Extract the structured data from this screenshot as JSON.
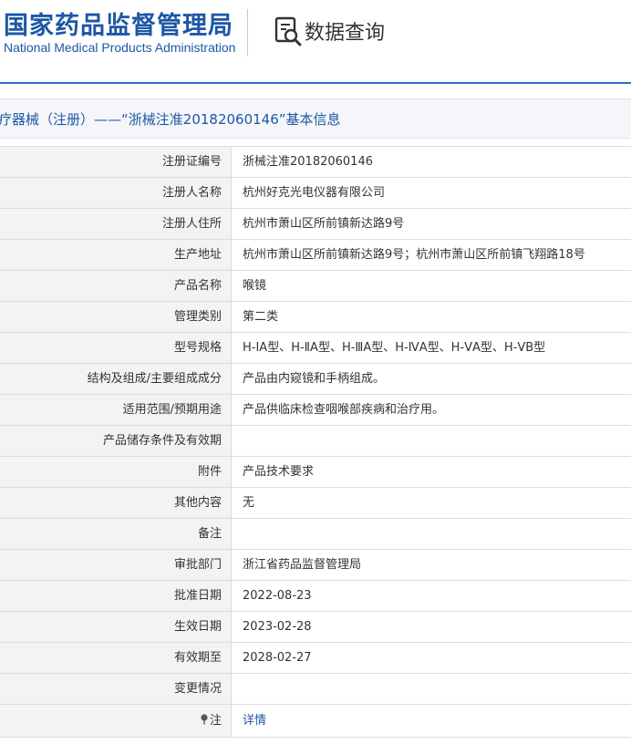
{
  "header": {
    "logo_cn": "国家药品监督管理局",
    "logo_en": "National Medical Products Administration",
    "query_label": "数据查询"
  },
  "record_title": {
    "prefix": "疗器械（注册）——“",
    "number": "浙械注准20182060146",
    "suffix": "”基本信息"
  },
  "rows": [
    {
      "label": "注册证编号",
      "value": "浙械注准20182060146"
    },
    {
      "label": "注册人名称",
      "value": "杭州好克光电仪器有限公司"
    },
    {
      "label": "注册人住所",
      "value": "杭州市萧山区所前镇新达路9号"
    },
    {
      "label": "生产地址",
      "value": "杭州市萧山区所前镇新达路9号；杭州市萧山区所前镇飞翔路18号"
    },
    {
      "label": "产品名称",
      "value": "喉镜"
    },
    {
      "label": "管理类别",
      "value": "第二类"
    },
    {
      "label": "型号规格",
      "value": "H-ⅠA型、H-ⅡA型、H-ⅢA型、H-ⅣA型、H-ⅤA型、H-ⅤB型"
    },
    {
      "label": "结构及组成/主要组成成分",
      "value": "产品由内窥镜和手柄组成。"
    },
    {
      "label": "适用范围/预期用途",
      "value": "产品供临床检查咽喉部疾病和治疗用。"
    },
    {
      "label": "产品储存条件及有效期",
      "value": ""
    },
    {
      "label": "附件",
      "value": "产品技术要求"
    },
    {
      "label": "其他内容",
      "value": "无"
    },
    {
      "label": "备注",
      "value": ""
    },
    {
      "label": "审批部门",
      "value": "浙江省药品监督管理局"
    },
    {
      "label": "批准日期",
      "value": "2022-08-23"
    },
    {
      "label": "生效日期",
      "value": "2023-02-28"
    },
    {
      "label": "有效期至",
      "value": "2028-02-27"
    },
    {
      "label": "变更情况",
      "value": ""
    }
  ],
  "note_row": {
    "label": "注",
    "link": "详情"
  },
  "icons": {
    "query": "document-search-icon",
    "note": "pin-icon"
  },
  "colors": {
    "brand_blue": "#1d57a6",
    "rule_blue": "#2a70c4",
    "label_bg": "#f3f3f3"
  }
}
